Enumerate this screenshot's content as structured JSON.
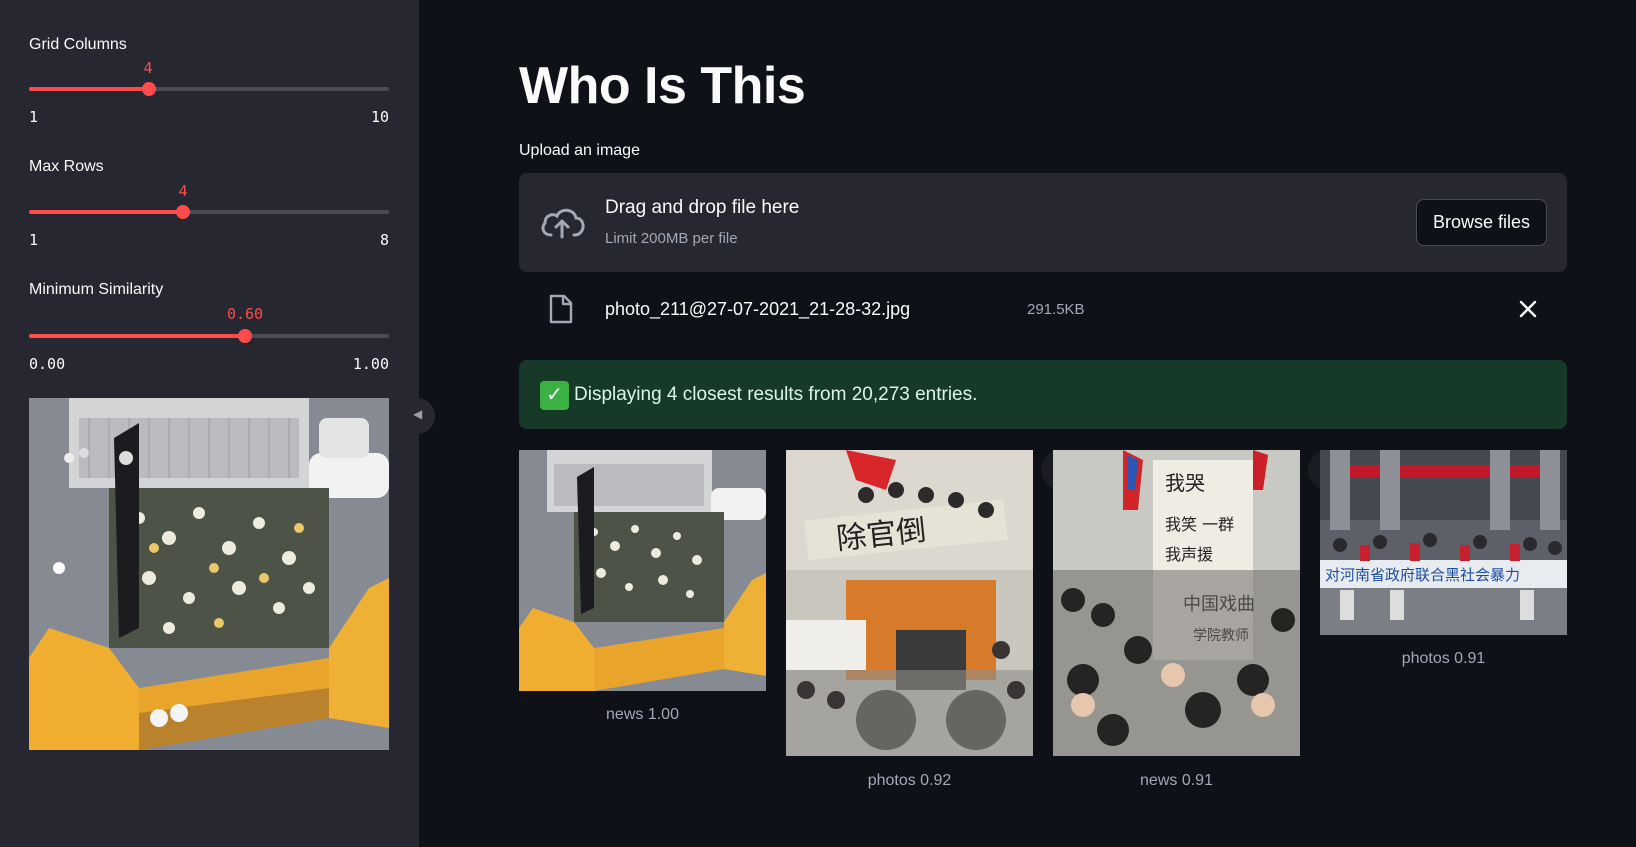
{
  "sidebar": {
    "sliders": [
      {
        "label": "Grid Columns",
        "value": "4",
        "min": "1",
        "max": "10",
        "fraction": 0.333
      },
      {
        "label": "Max Rows",
        "value": "4",
        "min": "1",
        "max": "8",
        "fraction": 0.429
      },
      {
        "label": "Minimum Similarity",
        "value": "0.60",
        "min": "0.00",
        "max": "1.00",
        "fraction": 0.6
      }
    ],
    "collapse_icon": "chevron-left-icon"
  },
  "main": {
    "title": "Who Is This",
    "upload": {
      "label": "Upload an image",
      "drop_title": "Drag and drop file here",
      "drop_sub": "Limit 200MB per file",
      "browse_label": "Browse files",
      "icon": "cloud-upload-icon"
    },
    "file": {
      "name": "photo_211@27-07-2021_21-28-32.jpg",
      "size": "291.5KB",
      "icon": "file-icon",
      "close_icon": "close-icon"
    },
    "status": {
      "icon": "check-icon",
      "text": "Displaying 4 closest results from 20,273 entries."
    },
    "results": [
      {
        "caption": "news 1.00"
      },
      {
        "caption": "photos 0.92"
      },
      {
        "caption": "news 0.91"
      },
      {
        "caption": "photos 0.91"
      }
    ]
  },
  "colors": {
    "accent": "#ff4b4b",
    "background": "#0e1117",
    "sidebar": "#262730",
    "success_bg": "#173928"
  }
}
